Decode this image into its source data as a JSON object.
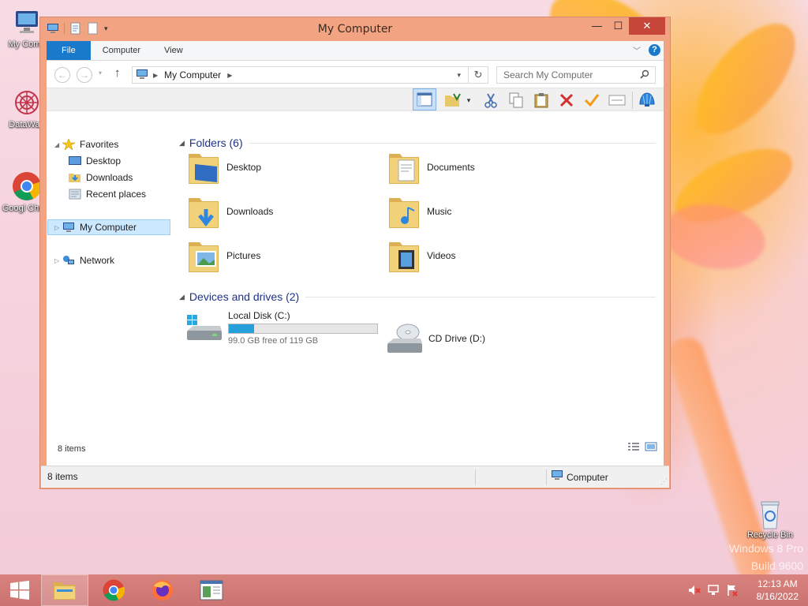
{
  "desktop": {
    "icons": [
      {
        "label": "My Comp",
        "icon": "computer-icon"
      },
      {
        "label": "DataWag",
        "icon": "datawagon-icon"
      },
      {
        "label": "Googl Chron",
        "icon": "chrome-icon"
      },
      {
        "label": "Recycle Bin",
        "icon": "recycle-bin-icon"
      }
    ],
    "watermark": [
      "Windows 8 Pro",
      "Build 9600"
    ]
  },
  "window": {
    "title": "My Computer",
    "controls": {
      "minimize": "—",
      "maximize": "☐",
      "close": "✕"
    }
  },
  "ribbon": {
    "tabs": [
      "File",
      "Computer",
      "View"
    ]
  },
  "address": {
    "path": "My Computer",
    "search_placeholder": "Search My Computer"
  },
  "navigation": {
    "favorites_label": "Favorites",
    "favorites": [
      "Desktop",
      "Downloads",
      "Recent places"
    ],
    "computer_label": "My Computer",
    "network_label": "Network"
  },
  "content": {
    "folders_header": "Folders (6)",
    "folders": [
      "Desktop",
      "Documents",
      "Downloads",
      "Music",
      "Pictures",
      "Videos"
    ],
    "devices_header": "Devices and drives (2)",
    "drives": [
      {
        "name": "Local Disk (C:)",
        "free_text": "99.0 GB free of 119 GB",
        "used_fraction": 0.168
      },
      {
        "name": "CD Drive (D:)"
      }
    ],
    "items_count": "8 items"
  },
  "statusbar": {
    "left": "8 items",
    "right": "Computer"
  },
  "taskbar": {
    "time": "12:13 AM",
    "date": "8/16/2022"
  },
  "colors": {
    "accent": "#1979ca",
    "window_frame": "#f2a482",
    "progress": "#26a0da"
  }
}
